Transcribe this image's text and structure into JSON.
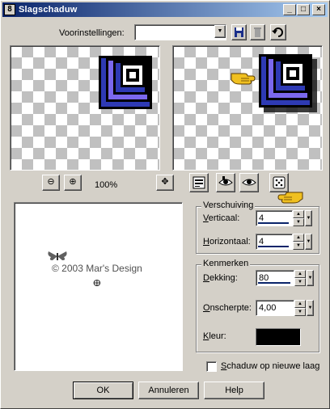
{
  "window": {
    "title": "Slagschaduw",
    "icon": "8"
  },
  "presets": {
    "label": "Voorinstellingen:",
    "value": ""
  },
  "zoom": {
    "level": "100%"
  },
  "preview_watermark": {
    "text": "© 2003 Mar's Design"
  },
  "offset": {
    "group_label": "Verschuiving",
    "vertical_label": "Verticaal:",
    "vertical_value": "4",
    "horizontal_label": "Horizontaal:",
    "horizontal_value": "4"
  },
  "properties": {
    "group_label": "Kenmerken",
    "opacity_label": "Dekking:",
    "opacity_value": "80",
    "blur_label": "Onscherpte:",
    "blur_value": "4,00",
    "color_label": "Kleur:",
    "color": "#000000"
  },
  "checkbox": {
    "label": "Schaduw op nieuwe laag",
    "checked": false
  },
  "buttons": {
    "ok": "OK",
    "cancel": "Annuleren",
    "help": "Help"
  },
  "colors": {
    "titlebar_start": "#0a246a",
    "titlebar_end": "#a6caf0",
    "square_purple": "#7b68ee",
    "square_blue": "#2e3ab4"
  }
}
